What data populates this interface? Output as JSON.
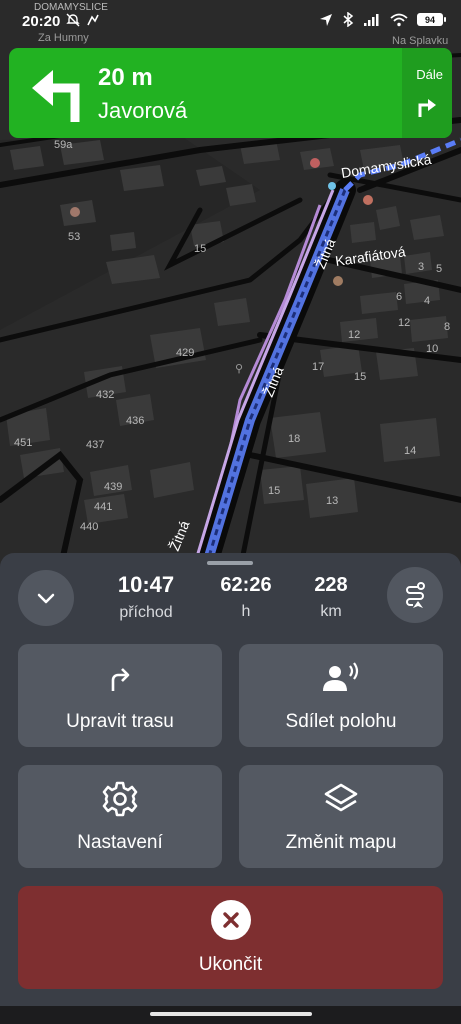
{
  "status_bar": {
    "time": "20:20",
    "overlay_text": "DOMAMYSLICE",
    "battery": "94"
  },
  "map": {
    "streets": {
      "zitna": "Žitná",
      "karafiatova": "Karafiátová",
      "domamyslicka": "Domamyslická",
      "za_humny": "Za Humny",
      "na_splavku": "Na Splavku"
    },
    "house_numbers": [
      "53",
      "15",
      "429",
      "432",
      "436",
      "451",
      "437",
      "439",
      "441",
      "440",
      "17",
      "15",
      "18",
      "14",
      "15",
      "13",
      "3",
      "5",
      "6",
      "4",
      "12",
      "10",
      "12",
      "8",
      "59a"
    ],
    "route_color": "#3f6bff"
  },
  "nav_banner": {
    "distance": "20 m",
    "street": "Javorová",
    "next_label": "Dále",
    "turn_icon": "turn-left-icon",
    "next_icon": "turn-right-icon",
    "color": "#22b222"
  },
  "trip": {
    "arrival_time": "10:47",
    "arrival_label": "příchod",
    "duration": "62:26",
    "duration_label": "h",
    "distance": "228",
    "distance_label": "km"
  },
  "actions": {
    "edit_route": "Upravit trasu",
    "share_location": "Sdílet polohu",
    "settings": "Nastavení",
    "change_map": "Změnit mapu",
    "end": "Ukončit"
  },
  "colors": {
    "sheet_bg": "#3a3e46",
    "tile_bg": "#545962",
    "end_bg": "#7e2f30"
  }
}
